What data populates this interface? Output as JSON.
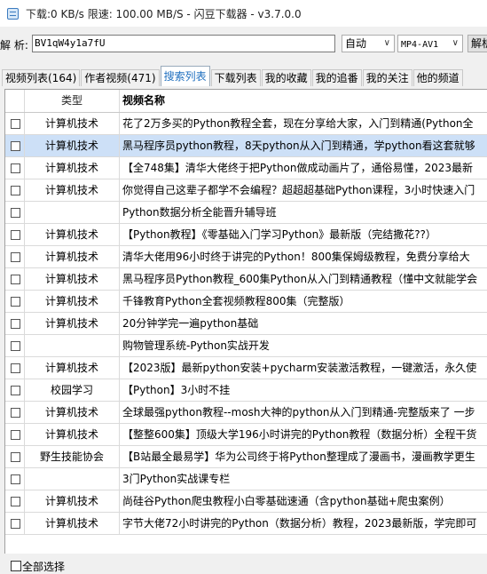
{
  "window": {
    "title": "下载:0 KB/s  限速: 100.00 MB/S  - 闪豆下载器 - v3.7.0.0"
  },
  "toolbar": {
    "parse_label": "解 析:",
    "bv_value": "BV1qW4y1a7fU",
    "quality_value": "自动",
    "format_value": "MP4-AV1",
    "parse_button": "解析"
  },
  "tabs": [
    {
      "label": "视频列表(164)"
    },
    {
      "label": "作者视频(471)"
    },
    {
      "label": "搜索列表"
    },
    {
      "label": "下载列表"
    },
    {
      "label": "我的收藏"
    },
    {
      "label": "我的追番"
    },
    {
      "label": "我的关注"
    },
    {
      "label": "他的频道"
    }
  ],
  "table": {
    "columns": [
      "类型",
      "视频名称"
    ],
    "rows": [
      {
        "type": "计算机技术",
        "name": "花了2万多买的Python教程全套，现在分享给大家，入门到精通(Python全"
      },
      {
        "type": "计算机技术",
        "name": "黑马程序员python教程，8天python从入门到精通，学python看这套就够"
      },
      {
        "type": "计算机技术",
        "name": "【全748集】清华大佬终于把Python做成动画片了，通俗易懂，2023最新"
      },
      {
        "type": "计算机技术",
        "name": "你觉得自己这辈子都学不会编程？超超超基础Python课程，3小时快速入门"
      },
      {
        "type": "",
        "name": "Python数据分析全能晋升辅导班"
      },
      {
        "type": "计算机技术",
        "name": "【Python教程】《零基础入门学习Python》最新版（完结撒花??）"
      },
      {
        "type": "计算机技术",
        "name": "清华大佬用96小时终于讲完的Python！800集保姆级教程，免费分享给大"
      },
      {
        "type": "计算机技术",
        "name": "黑马程序员Python教程_600集Python从入门到精通教程（懂中文就能学会"
      },
      {
        "type": "计算机技术",
        "name": "千锋教育Python全套视频教程800集（完整版）"
      },
      {
        "type": "计算机技术",
        "name": "20分钟学完一遍python基础"
      },
      {
        "type": "",
        "name": "购物管理系统-Python实战开发"
      },
      {
        "type": "计算机技术",
        "name": "【2023版】最新python安装+pycharm安装激活教程，一键激活，永久使"
      },
      {
        "type": "校园学习",
        "name": "【Python】3小时不挂"
      },
      {
        "type": "计算机技术",
        "name": "全球最强python教程--mosh大神的python从入门到精通-完整版来了 一步"
      },
      {
        "type": "计算机技术",
        "name": "【整整600集】顶级大学196小时讲完的Python教程（数据分析）全程干货"
      },
      {
        "type": "野生技能协会",
        "name": "【B站最全最易学】华为公司终于将Python整理成了漫画书，漫画教学更生"
      },
      {
        "type": "",
        "name": "3门Python实战课专栏"
      },
      {
        "type": "计算机技术",
        "name": "尚硅谷Python爬虫教程小白零基础速通（含python基础+爬虫案例）"
      },
      {
        "type": "计算机技术",
        "name": "字节大佬72小时讲完的Python（数据分析）教程，2023最新版，学完即可"
      }
    ]
  },
  "footer": {
    "select_all_label": "全部选择"
  },
  "colors": {
    "selected_row": "#cde0f7",
    "active_tab_text": "#1f6fbf"
  }
}
